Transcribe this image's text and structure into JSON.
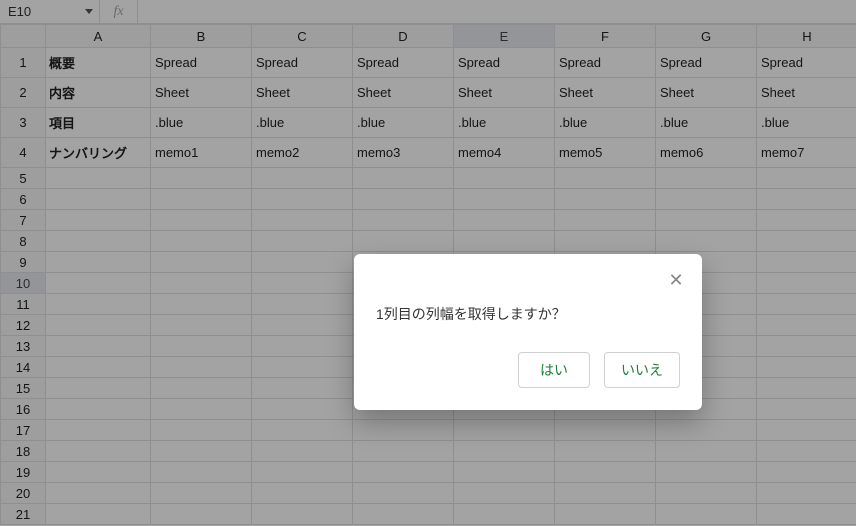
{
  "namebox": {
    "value": "E10"
  },
  "fx": {
    "label": "fx",
    "value": ""
  },
  "columns": [
    "A",
    "B",
    "C",
    "D",
    "E",
    "F",
    "G",
    "H"
  ],
  "active_col": "E",
  "active_row": 10,
  "row_count": 21,
  "colA": {
    "r1": "概要",
    "r2": "内容",
    "r3": "項目",
    "r4": "ナンバリング"
  },
  "rows": {
    "r1": [
      "Spread",
      "Spread",
      "Spread",
      "Spread",
      "Spread",
      "Spread",
      "Spread"
    ],
    "r2": [
      "Sheet",
      "Sheet",
      "Sheet",
      "Sheet",
      "Sheet",
      "Sheet",
      "Sheet"
    ],
    "r3": [
      ".blue",
      ".blue",
      ".blue",
      ".blue",
      ".blue",
      ".blue",
      ".blue"
    ],
    "r4": [
      "memo1",
      "memo2",
      "memo3",
      "memo4",
      "memo5",
      "memo6",
      "memo7"
    ]
  },
  "dialog": {
    "message": "1列目の列幅を取得しますか？",
    "yes": "はい",
    "no": "いいえ"
  }
}
